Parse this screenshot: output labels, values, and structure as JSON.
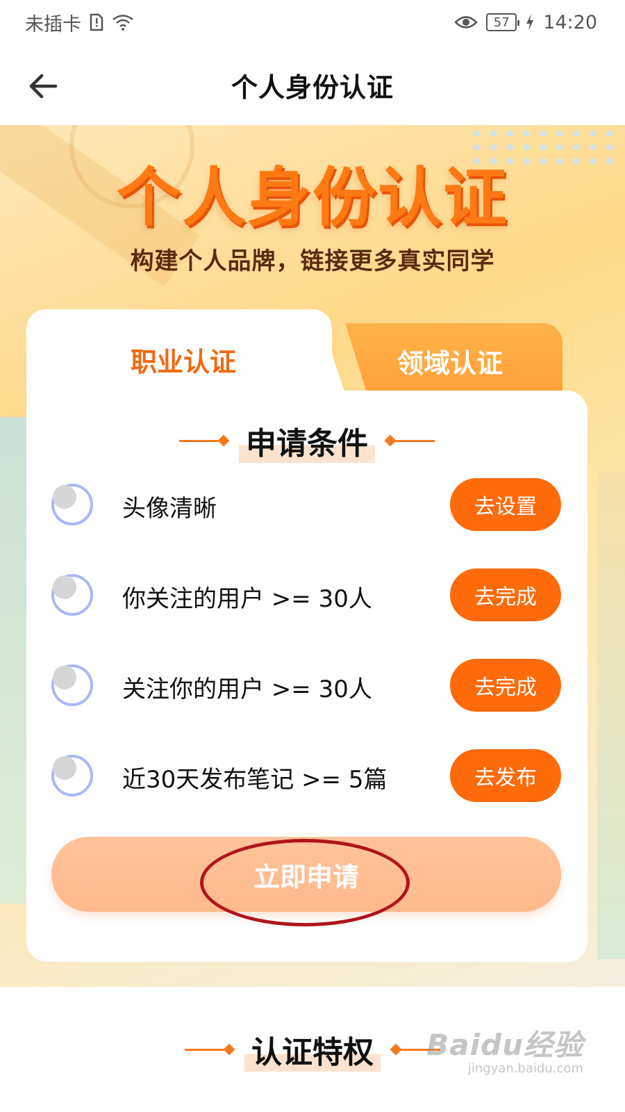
{
  "status_bar": {
    "carrier": "未插卡",
    "battery": "57",
    "time": "14:20"
  },
  "header": {
    "title": "个人身份认证"
  },
  "hero": {
    "title": "个人身份认证",
    "subtitle": "构建个人品牌，链接更多真实同学"
  },
  "tabs": [
    {
      "label": "职业认证",
      "active": true
    },
    {
      "label": "领域认证",
      "active": false
    }
  ],
  "conditions": {
    "title": "申请条件",
    "items": [
      {
        "text": "头像清晰",
        "action": "去设置"
      },
      {
        "text": "你关注的用户 >= 30人",
        "action": "去完成"
      },
      {
        "text": "关注你的用户 >= 30人",
        "action": "去完成"
      },
      {
        "text": "近30天发布笔记 >= 5篇",
        "action": "去发布"
      }
    ]
  },
  "apply_button": "立即申请",
  "privileges": {
    "title": "认证特权"
  },
  "watermark": {
    "logo": "Baidu经验",
    "url": "jingyan.baidu.com"
  }
}
